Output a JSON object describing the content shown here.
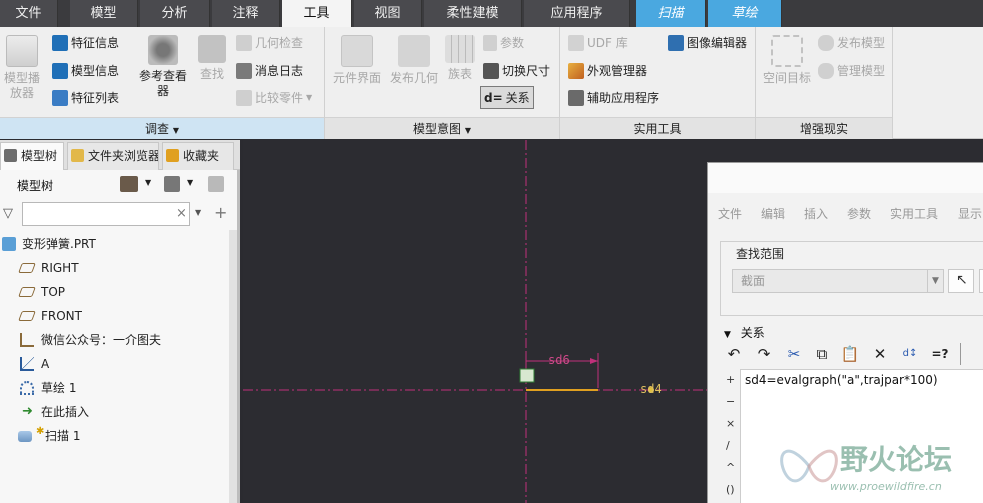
{
  "menu_tabs": [
    {
      "label": "文件"
    },
    {
      "label": "模型"
    },
    {
      "label": "分析"
    },
    {
      "label": "注释"
    },
    {
      "label": "工具"
    },
    {
      "label": "视图"
    },
    {
      "label": "柔性建模"
    },
    {
      "label": "应用程序"
    },
    {
      "label": "扫描"
    },
    {
      "label": "草绘"
    }
  ],
  "ribbon": {
    "investigate": {
      "label": "调查",
      "model_player": "模型播放器",
      "feature_info": "特征信息",
      "model_info": "模型信息",
      "feature_list": "特征列表",
      "reference_viewer": "参考查看器",
      "find": "查找",
      "geometry_check": "几何检查",
      "message_log": "消息日志",
      "compare_part": "比较零件"
    },
    "model_intent": {
      "label": "模型意图",
      "component_interface": "元件界面",
      "publish_geometry": "发布几何",
      "family_table": "族表",
      "parameters": "参数",
      "switch_dimensions": "切换尺寸",
      "relations": "关系"
    },
    "utilities": {
      "label": "实用工具",
      "udf_library": "UDF 库",
      "appearance_manager": "外观管理器",
      "auxiliary_apps": "辅助应用程序",
      "image_editor": "图像编辑器"
    },
    "augmented_reality": {
      "label": "增强现实",
      "space_target": "空间目标",
      "publish_model": "发布模型",
      "manage_model": "管理模型"
    }
  },
  "left_tabs": [
    {
      "label": "模型树"
    },
    {
      "label": "文件夹浏览器"
    },
    {
      "label": "收藏夹"
    }
  ],
  "model_tree": {
    "title": "模型树",
    "search_value": "",
    "nodes": [
      {
        "label": "变形弹簧.PRT",
        "icon": "part-icon"
      },
      {
        "label": "RIGHT",
        "icon": "datum-plane-icon"
      },
      {
        "label": "TOP",
        "icon": "datum-plane-icon"
      },
      {
        "label": "FRONT",
        "icon": "datum-plane-icon"
      },
      {
        "label": "微信公众号：一介图夫",
        "icon": "coordinate-system-icon"
      },
      {
        "label": "A",
        "icon": "graph-icon"
      },
      {
        "label": "草绘 1",
        "icon": "sketch-icon"
      },
      {
        "label": "在此插入",
        "icon": "insert-here-icon"
      },
      {
        "label": "扫描 1",
        "icon": "sweep-icon"
      }
    ]
  },
  "canvas": {
    "dimension_label": "sd6",
    "sketch_label": "sd4"
  },
  "relations_dialog": {
    "menu": [
      "文件",
      "编辑",
      "插入",
      "参数",
      "实用工具",
      "显示"
    ],
    "find_scope_label": "查找范围",
    "find_scope_value": "截面",
    "relations_header": "关系",
    "relation_text": "sd4=evalgraph(\"a\",trajpar*100)",
    "operators": [
      "+",
      "−",
      "×",
      "/",
      "^",
      "()"
    ]
  },
  "watermark": {
    "text": "野火论坛",
    "url": "www.proewildfire.cn"
  },
  "colors": {
    "tab_active": "#f4f4f4",
    "tab_context": "#4aa8e0",
    "canvas_bg": "#2c2c31",
    "axis_magenta": "#c0307a",
    "section_orange": "#e0a020"
  }
}
